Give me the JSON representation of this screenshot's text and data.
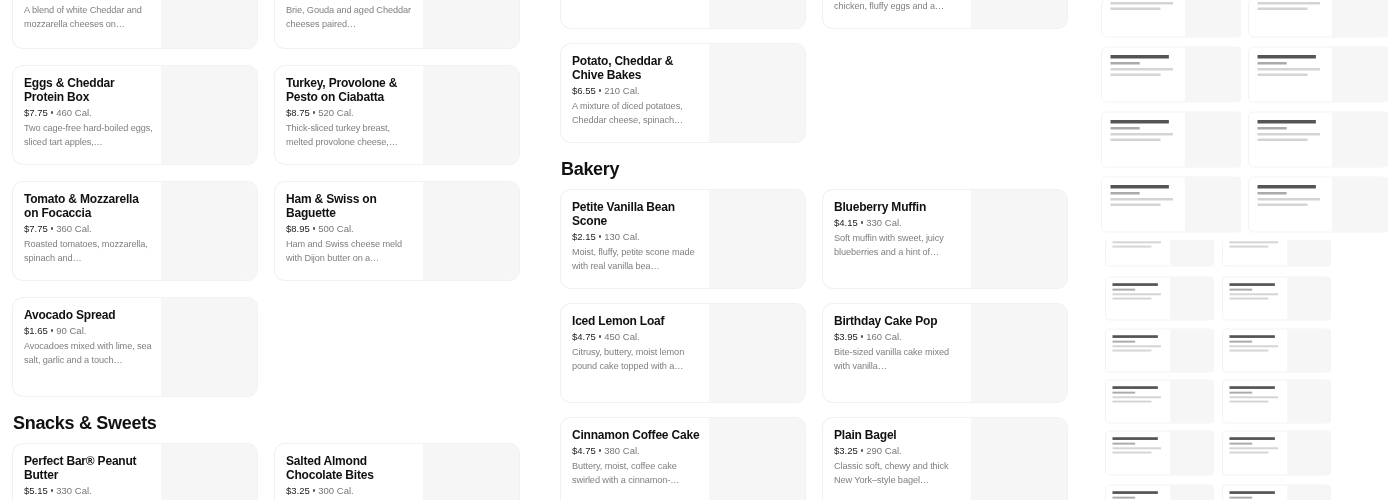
{
  "panels": [
    {
      "blocks": [
        {
          "kind": "cards",
          "cards": [
            {
              "kind": "clipped",
              "description": "A blend of white Cheddar and mozzarella cheeses on…"
            },
            {
              "kind": "clipped",
              "description": "Brie, Gouda and aged Cheddar cheeses paired…"
            },
            {
              "kind": "full",
              "name": "Eggs & Cheddar Protein Box",
              "price": "$7.75",
              "calories": "460 Cal.",
              "description": "Two cage-free hard-boiled eggs, sliced tart apples,…"
            },
            {
              "kind": "full",
              "name": "Turkey, Provolone & Pesto on Ciabatta",
              "price": "$8.75",
              "calories": "520 Cal.",
              "description": "Thick-sliced turkey breast, melted provolone cheese,…"
            },
            {
              "kind": "full",
              "name": "Tomato & Mozzarella on Focaccia",
              "price": "$7.75",
              "calories": "360 Cal.",
              "description": "Roasted tomatoes, mozzarella, spinach and…"
            },
            {
              "kind": "full",
              "name": "Ham & Swiss on Baguette",
              "price": "$8.95",
              "calories": "500 Cal.",
              "description": "Ham and Swiss cheese meld with Dijon butter on a…"
            },
            {
              "kind": "full",
              "name": "Avocado Spread",
              "price": "$1.65",
              "calories": "90 Cal.",
              "description": "Avocadoes mixed with lime, sea salt, garlic and a touch…"
            }
          ]
        },
        {
          "kind": "heading",
          "text": "Snacks & Sweets"
        },
        {
          "kind": "cards",
          "cards": [
            {
              "kind": "full",
              "name": "Perfect Bar® Peanut Butter",
              "price": "$5.15",
              "calories": "330 Cal."
            },
            {
              "kind": "full",
              "name": "Salted Almond Chocolate Bites",
              "price": "$3.25",
              "calories": "300 Cal."
            }
          ]
        }
      ]
    },
    {
      "blocks": [
        {
          "kind": "cards",
          "cards": [
            {
              "kind": "clipped"
            },
            {
              "kind": "clipped",
              "description": "chicken, fluffy eggs and a…"
            },
            {
              "kind": "full",
              "name": "Potato, Cheddar & Chive Bakes",
              "price": "$6.55",
              "calories": "210 Cal.",
              "description": "A mixture of diced potatoes, Cheddar cheese, spinach…"
            }
          ]
        },
        {
          "kind": "heading",
          "text": "Bakery"
        },
        {
          "kind": "cards",
          "cards": [
            {
              "kind": "full",
              "name": "Petite Vanilla Bean Scone",
              "price": "$2.15",
              "calories": "130 Cal.",
              "description": "Moist, fluffy, petite scone made with real vanilla bea…"
            },
            {
              "kind": "full",
              "name": "Blueberry Muffin",
              "price": "$4.15",
              "calories": "330 Cal.",
              "description": "Soft muffin with sweet, juicy blueberries and a hint of…"
            },
            {
              "kind": "full",
              "name": "Iced Lemon Loaf",
              "price": "$4.75",
              "calories": "450 Cal.",
              "description": "Citrusy, buttery, moist lemon pound cake topped with a…"
            },
            {
              "kind": "full",
              "name": "Birthday Cake Pop",
              "price": "$3.95",
              "calories": "160 Cal.",
              "description": "Bite-sized vanilla cake mixed with vanilla…"
            },
            {
              "kind": "full",
              "name": "Cinnamon Coffee Cake",
              "price": "$4.75",
              "calories": "380 Cal.",
              "description": "Buttery, moist, coffee cake swirled with a cinnamon-…"
            },
            {
              "kind": "full",
              "name": "Plain Bagel",
              "price": "$3.25",
              "calories": "290 Cal.",
              "description": "Classic soft, chewy and thick New York–style bagel…"
            }
          ]
        }
      ]
    }
  ]
}
